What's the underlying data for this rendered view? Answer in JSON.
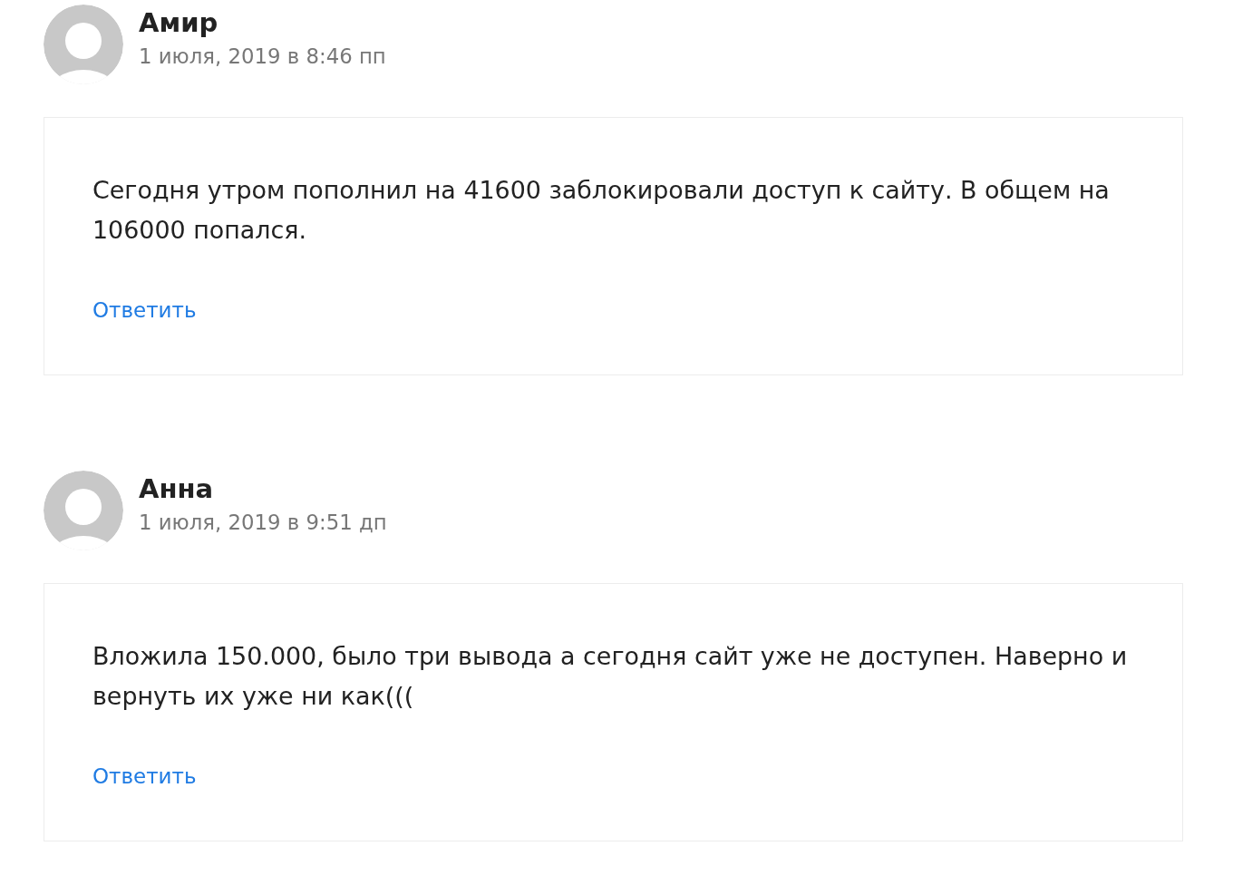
{
  "comments": [
    {
      "author": "Амир",
      "date": "1 июля, 2019 в 8:46 пп",
      "text": "Сегодня утром пополнил на 41600 заблокировали доступ к сайту. В общем на 106000 попался.",
      "reply_link": "Ответить"
    },
    {
      "author": "Анна",
      "date": "1 июля, 2019 в 9:51 дп",
      "text": "Вложила 150.000, было три вывода а сегодня сайт уже не доступен. Наверно и вернуть их уже ни как(((",
      "reply_link": "Ответить"
    }
  ]
}
